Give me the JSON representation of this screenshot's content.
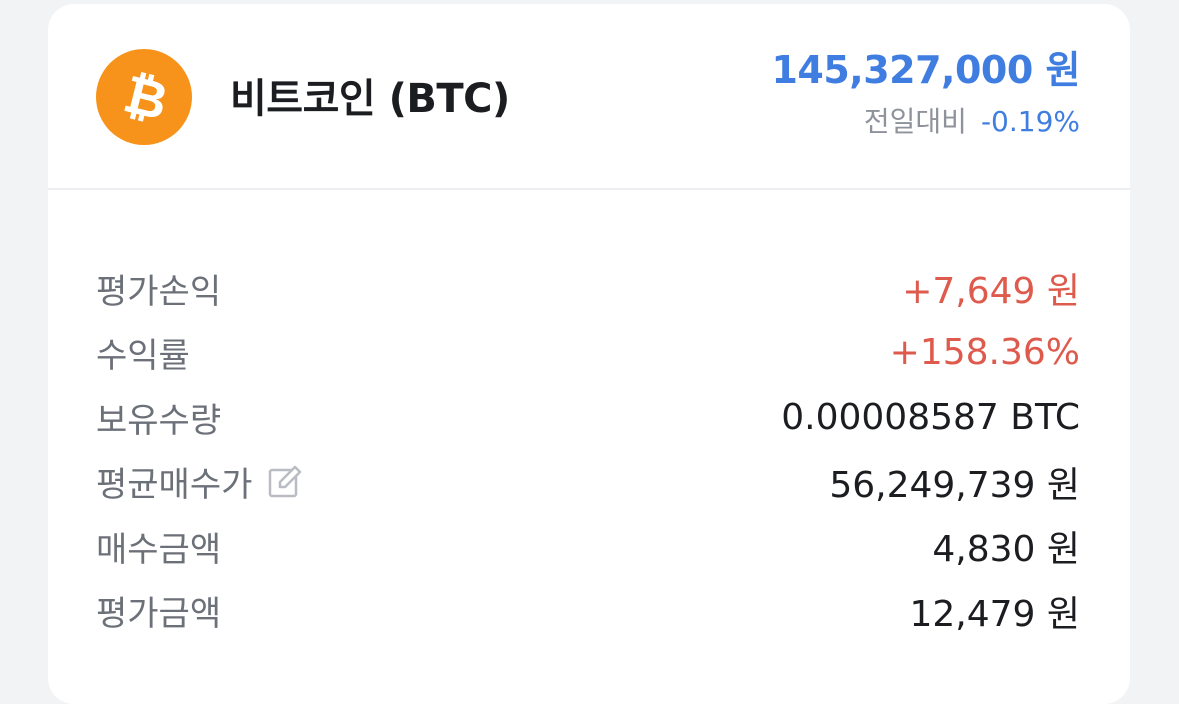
{
  "coin": {
    "name": "비트코인 (BTC)",
    "icon": "bitcoin-icon",
    "brand_color": "#f7931a"
  },
  "price": {
    "value": "145,327,000 원",
    "change_label": "전일대비",
    "change_value": "-0.19%",
    "color": "#3f7ee0"
  },
  "details": {
    "pnl": {
      "label": "평가손익",
      "value": "+7,649 원"
    },
    "return_rate": {
      "label": "수익률",
      "value": "+158.36%"
    },
    "holdings": {
      "label": "보유수량",
      "value": "0.00008587 BTC"
    },
    "avg_price": {
      "label": "평균매수가",
      "value": "56,249,739 원",
      "edit_icon": "edit-icon"
    },
    "buy_amount": {
      "label": "매수금액",
      "value": "4,830 원"
    },
    "eval_amount": {
      "label": "평가금액",
      "value": "12,479 원"
    }
  },
  "colors": {
    "positive": "#de5a4c",
    "negative": "#3f7ee0"
  }
}
